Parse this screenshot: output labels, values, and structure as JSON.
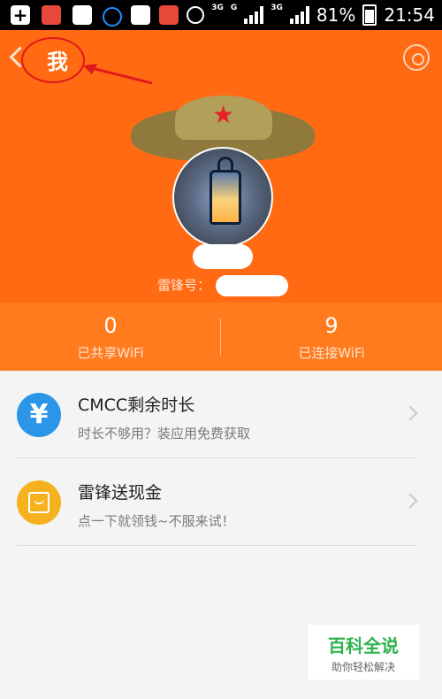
{
  "status_bar": {
    "network_type_1": "3G",
    "network_type_2": "G",
    "network_type_3": "3G",
    "battery": "81%",
    "time": "21:54"
  },
  "header": {
    "title": "我",
    "id_label": "雷锋号："
  },
  "stats": [
    {
      "value": "0",
      "label": "已共享WiFi"
    },
    {
      "value": "9",
      "label": "已连接WiFi"
    }
  ],
  "list": [
    {
      "title": "CMCC剩余时长",
      "subtitle": "时长不够用？装应用免费获取",
      "icon_glyph": "¥"
    },
    {
      "title": "雷锋送现金",
      "subtitle": "点一下就领钱~不服来试！"
    }
  ],
  "watermark": {
    "brand": "百科全说",
    "tagline": "助你轻松解决"
  }
}
